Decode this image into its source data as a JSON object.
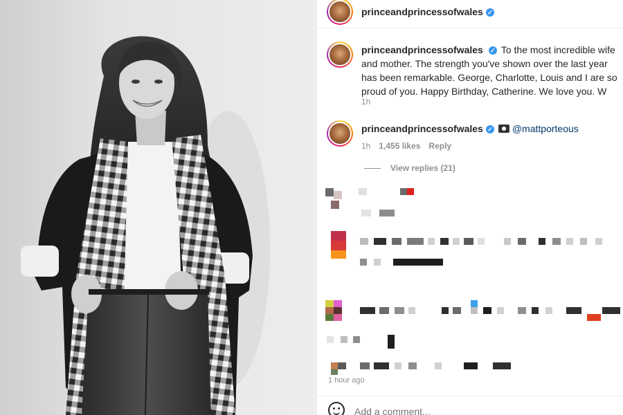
{
  "header": {
    "username": "princeandprincessofwales",
    "verified": true
  },
  "caption": {
    "username": "princeandprincessofwales",
    "text": "To the most incredible wife and mother. The strength you've shown over the last year has been remarkable. George, Charlotte, Louis and I are so proud of you. Happy Birthday, Catherine. We love you. W",
    "time": "1h"
  },
  "comment": {
    "username": "princeandprincessofwales",
    "mention": "@mattporteous",
    "time": "1h",
    "likes": "1,455 likes",
    "reply": "Reply",
    "view_replies": "View replies (21)"
  },
  "post": {
    "time_ago": "1 hour ago"
  },
  "comment_box": {
    "placeholder": "Add a comment..."
  },
  "colors": {
    "verified": "#3897f0",
    "mention": "#00376b",
    "meta": "#8e8e8e"
  },
  "icons": [
    "verified-badge-icon",
    "camera-icon",
    "smiley-icon"
  ]
}
